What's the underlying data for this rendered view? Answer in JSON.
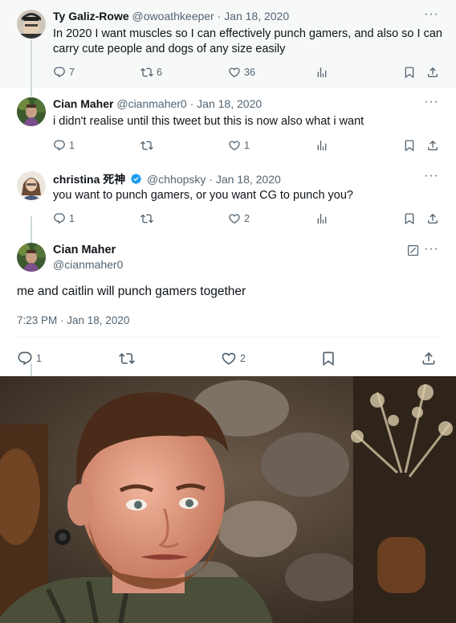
{
  "thread": [
    {
      "author_name": "Ty Galiz-Rowe",
      "handle": "@owoathkeeper",
      "date": "· Jan 18, 2020",
      "text": "In 2020 I want muscles so I can effectively punch gamers, and also so I can carry cute people and dogs of any size easily",
      "replies": "7",
      "retweets": "6",
      "likes": "36",
      "avatar_colors": [
        "#2b2b2b",
        "#d9c8b4"
      ]
    },
    {
      "author_name": "Cian Maher",
      "handle": "@cianmaher0",
      "date": "· Jan 18, 2020",
      "text": "i didn't realise until this tweet but this is now also what i want",
      "replies": "1",
      "retweets": "",
      "likes": "1",
      "avatar_colors": [
        "#3f6a34",
        "#8a5b7a"
      ]
    },
    {
      "author_name": "christina 死神",
      "handle": "@chhopsky",
      "date": "· Jan 18, 2020",
      "text": "you want to punch gamers, or you want CG to punch you?",
      "replies": "1",
      "retweets": "",
      "likes": "2",
      "verified": true,
      "avatar_colors": [
        "#e9e2d9",
        "#6a4a36"
      ]
    }
  ],
  "main_tweet": {
    "author_name": "Cian Maher",
    "handle": "@cianmaher0",
    "text": "me and caitlin will punch gamers together",
    "timestamp": "7:23 PM · Jan 18, 2020",
    "replies": "1",
    "retweets": "",
    "likes": "2"
  },
  "icons": {
    "reply": "speech-bubble-icon",
    "retweet": "retweet-arrows-icon",
    "like": "heart-icon",
    "views": "bar-chart-icon",
    "bookmark": "bookmark-icon",
    "share": "upload-icon",
    "more": "ellipsis-icon",
    "grok": "grok-icon",
    "verified": "verified-badge-icon"
  },
  "colors": {
    "text_primary": "#0f1419",
    "text_secondary": "#536471",
    "verified_blue": "#1d9bf0",
    "rail": "#cfd9de",
    "highlight_bg": "#f7f9f9"
  },
  "photo": {
    "description_icon": "man-portrait-image"
  }
}
